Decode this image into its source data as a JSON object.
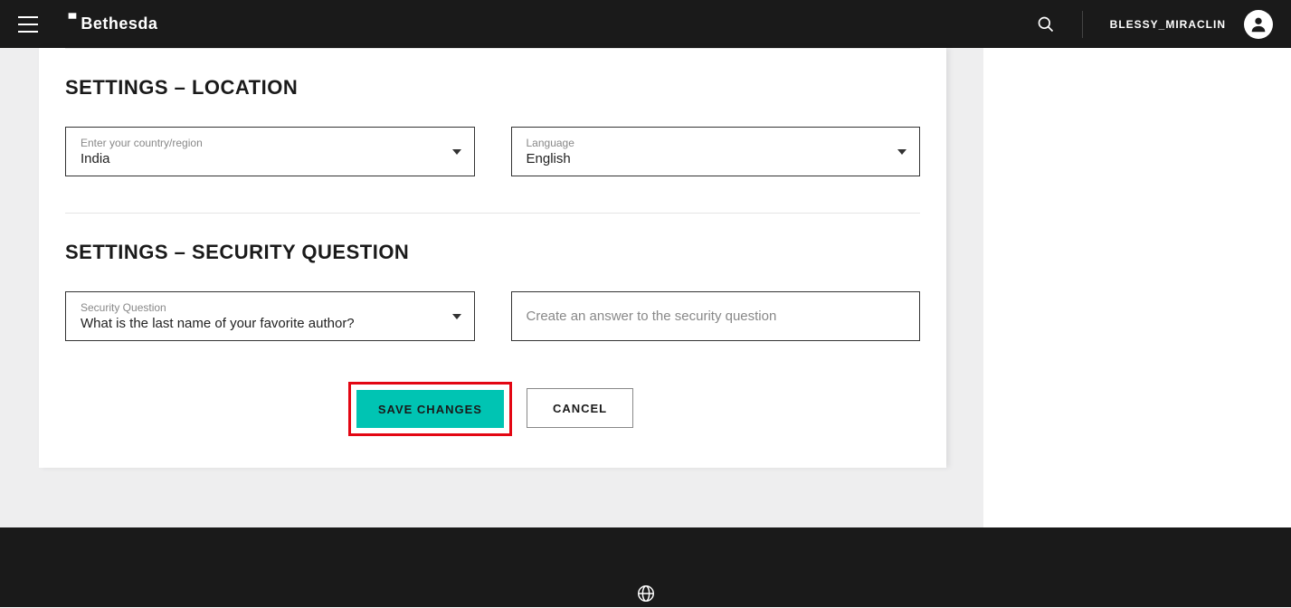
{
  "header": {
    "brand": "Bethesda",
    "username": "BLESSY_MIRACLIN"
  },
  "location": {
    "title": "SETTINGS – LOCATION",
    "country_label": "Enter your country/region",
    "country_value": "India",
    "language_label": "Language",
    "language_value": "English"
  },
  "security": {
    "title": "SETTINGS – SECURITY QUESTION",
    "question_label": "Security Question",
    "question_value": "What is the last name of your favorite author?",
    "answer_placeholder": "Create an answer to the security question"
  },
  "buttons": {
    "save": "SAVE CHANGES",
    "cancel": "CANCEL"
  }
}
